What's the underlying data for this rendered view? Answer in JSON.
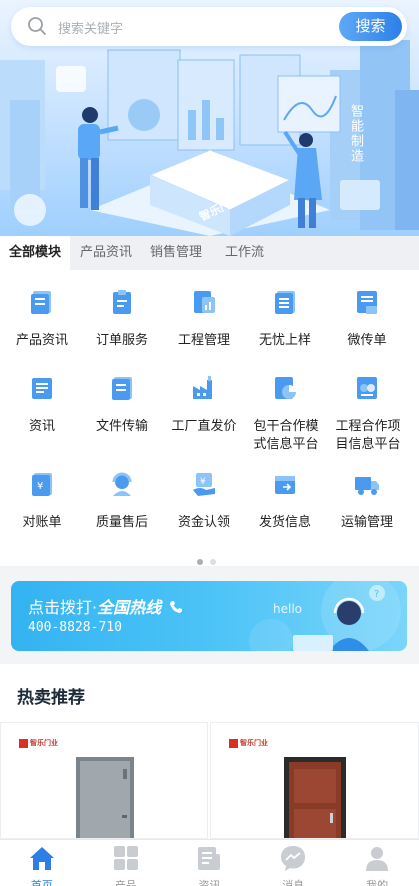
{
  "search": {
    "placeholder": "搜索关键字",
    "button_label": "搜索"
  },
  "banner": {
    "brand_text": "智乐门业",
    "side_text": "智能制造"
  },
  "tabs": [
    {
      "label": "全部模块",
      "active": true
    },
    {
      "label": "产品资讯",
      "active": false
    },
    {
      "label": "销售管理",
      "active": false
    },
    {
      "label": "工作流",
      "active": false
    }
  ],
  "modules": [
    {
      "label": "产品资讯",
      "icon": "newspaper-icon"
    },
    {
      "label": "订单服务",
      "icon": "clipboard-icon"
    },
    {
      "label": "工程管理",
      "icon": "document-chart-icon"
    },
    {
      "label": "无忧上样",
      "icon": "list-document-icon"
    },
    {
      "label": "微传单",
      "icon": "flyer-icon"
    },
    {
      "label": "资讯",
      "icon": "news-icon"
    },
    {
      "label": "文件传输",
      "icon": "file-transfer-icon"
    },
    {
      "label": "工厂直发价",
      "icon": "factory-icon"
    },
    {
      "label": "包干合作模式信息平台",
      "icon": "pie-chart-doc-icon"
    },
    {
      "label": "工程合作项目信息平台",
      "icon": "cooperation-icon"
    },
    {
      "label": "对账单",
      "icon": "statement-icon"
    },
    {
      "label": "质量售后",
      "icon": "headset-service-icon"
    },
    {
      "label": "资金认领",
      "icon": "money-claim-icon"
    },
    {
      "label": "发货信息",
      "icon": "shipping-box-icon"
    },
    {
      "label": "运输管理",
      "icon": "truck-icon"
    }
  ],
  "pager": {
    "pages": 2,
    "current": 1
  },
  "hotline": {
    "title_prefix": "点击拨打·",
    "title_emphasis": "全国热线",
    "number": "400-8828-710",
    "hello": "hello"
  },
  "hot": {
    "title": "热卖推荐",
    "products": [
      {
        "brand": "智乐门业",
        "door_color": "#8f979e"
      },
      {
        "brand": "智乐门业",
        "door_color": "#8a3b28"
      }
    ]
  },
  "bottom_nav": [
    {
      "label": "首页",
      "icon": "home-icon",
      "active": true
    },
    {
      "label": "产品",
      "icon": "grid-icon",
      "active": false
    },
    {
      "label": "资讯",
      "icon": "news-icon",
      "active": false
    },
    {
      "label": "消息",
      "icon": "message-icon",
      "active": false
    },
    {
      "label": "我的",
      "icon": "user-icon",
      "active": false
    }
  ],
  "colors": {
    "accent": "#2d7fe7",
    "hotline_bg": "#4cc3f7",
    "icon_blue": "#4a9bf0"
  }
}
